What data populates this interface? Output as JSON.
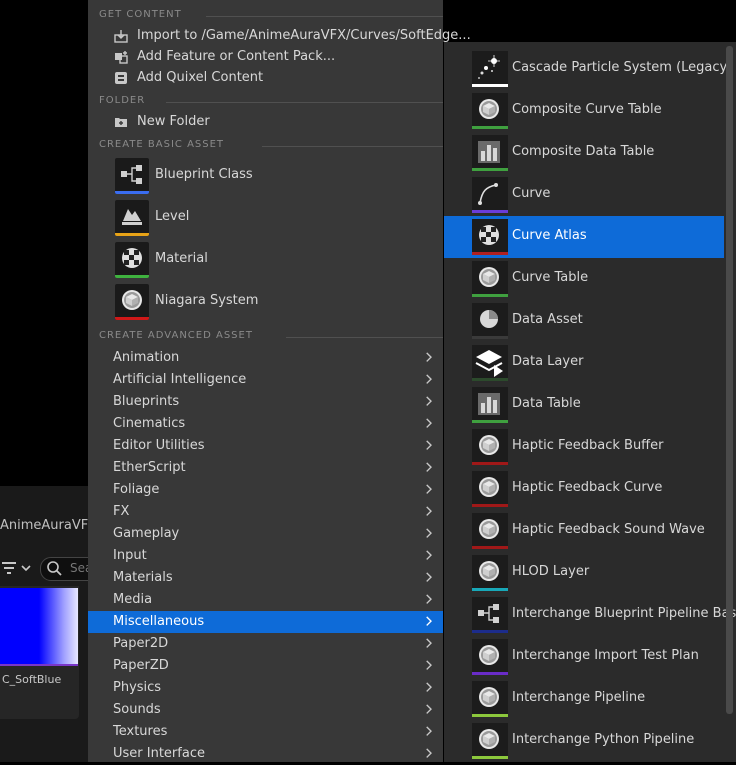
{
  "background": {
    "path_fragment": "AnimeAuraVFX",
    "search_placeholder": "Sea",
    "asset_tile_label": "C_SoftBlue"
  },
  "menu": {
    "get_content": {
      "header": "GET CONTENT",
      "items": [
        {
          "label": "Import to /Game/AnimeAuraVFX/Curves/SoftEdge...",
          "icon": "import-icon"
        },
        {
          "label": "Add Feature or Content Pack...",
          "icon": "feature-pack-icon"
        },
        {
          "label": "Add Quixel Content",
          "icon": "quixel-icon"
        }
      ]
    },
    "folder": {
      "header": "FOLDER",
      "items": [
        {
          "label": "New Folder",
          "icon": "new-folder-icon"
        }
      ]
    },
    "basic": {
      "header": "CREATE BASIC ASSET",
      "items": [
        {
          "label": "Blueprint Class",
          "icon": "blueprint-icon",
          "color": "#3a6df0"
        },
        {
          "label": "Level",
          "icon": "level-icon",
          "color": "#e8a317"
        },
        {
          "label": "Material",
          "icon": "material-icon",
          "color": "#3fb23f"
        },
        {
          "label": "Niagara System",
          "icon": "niagara-icon",
          "color": "#d01818"
        }
      ]
    },
    "advanced": {
      "header": "CREATE ADVANCED ASSET",
      "items": [
        {
          "label": "Animation"
        },
        {
          "label": "Artificial Intelligence"
        },
        {
          "label": "Blueprints"
        },
        {
          "label": "Cinematics"
        },
        {
          "label": "Editor Utilities"
        },
        {
          "label": "EtherScript"
        },
        {
          "label": "Foliage"
        },
        {
          "label": "FX"
        },
        {
          "label": "Gameplay"
        },
        {
          "label": "Input"
        },
        {
          "label": "Materials"
        },
        {
          "label": "Media"
        },
        {
          "label": "Miscellaneous",
          "selected": true
        },
        {
          "label": "Paper2D"
        },
        {
          "label": "PaperZD"
        },
        {
          "label": "Physics"
        },
        {
          "label": "Sounds"
        },
        {
          "label": "Textures"
        },
        {
          "label": "User Interface"
        }
      ]
    }
  },
  "submenu": {
    "items": [
      {
        "label": "Cascade Particle System (Legacy)",
        "icon": "particle-icon",
        "color": "#ffffff"
      },
      {
        "label": "Composite Curve Table",
        "icon": "sphere-icon",
        "color": "#3fa03f"
      },
      {
        "label": "Composite Data Table",
        "icon": "data-table-icon",
        "color": "#3fa03f"
      },
      {
        "label": "Curve",
        "icon": "curve-icon",
        "color": "#6a3cd8"
      },
      {
        "label": "Curve Atlas",
        "icon": "checker-icon",
        "color": "#b02020",
        "selected": true
      },
      {
        "label": "Curve Table",
        "icon": "sphere-icon",
        "color": "#3fa03f"
      },
      {
        "label": "Data Asset",
        "icon": "pie-icon",
        "color": "#3a3a3a"
      },
      {
        "label": "Data Layer",
        "icon": "layers-icon",
        "color": "#2c4a2c"
      },
      {
        "label": "Data Table",
        "icon": "data-table-icon",
        "color": "#3fa03f"
      },
      {
        "label": "Haptic Feedback Buffer",
        "icon": "sphere-icon",
        "color": "#a01818"
      },
      {
        "label": "Haptic Feedback Curve",
        "icon": "sphere-icon",
        "color": "#a01818"
      },
      {
        "label": "Haptic Feedback Sound Wave",
        "icon": "sphere-icon",
        "color": "#a01818"
      },
      {
        "label": "HLOD Layer",
        "icon": "sphere-icon",
        "color": "#18a8b8"
      },
      {
        "label": "Interchange Blueprint Pipeline Base",
        "icon": "blueprint-icon",
        "color": "#1c2c8c"
      },
      {
        "label": "Interchange Import Test Plan",
        "icon": "sphere-icon",
        "color": "#6a2cc8"
      },
      {
        "label": "Interchange Pipeline",
        "icon": "sphere-icon",
        "color": "#8cc83c"
      },
      {
        "label": "Interchange Python Pipeline",
        "icon": "sphere-icon",
        "color": "#8cc83c"
      }
    ]
  },
  "colors": {
    "selection": "#0e6bd8",
    "menu_bg": "#383838",
    "submenu_bg": "#2b2b2b"
  }
}
